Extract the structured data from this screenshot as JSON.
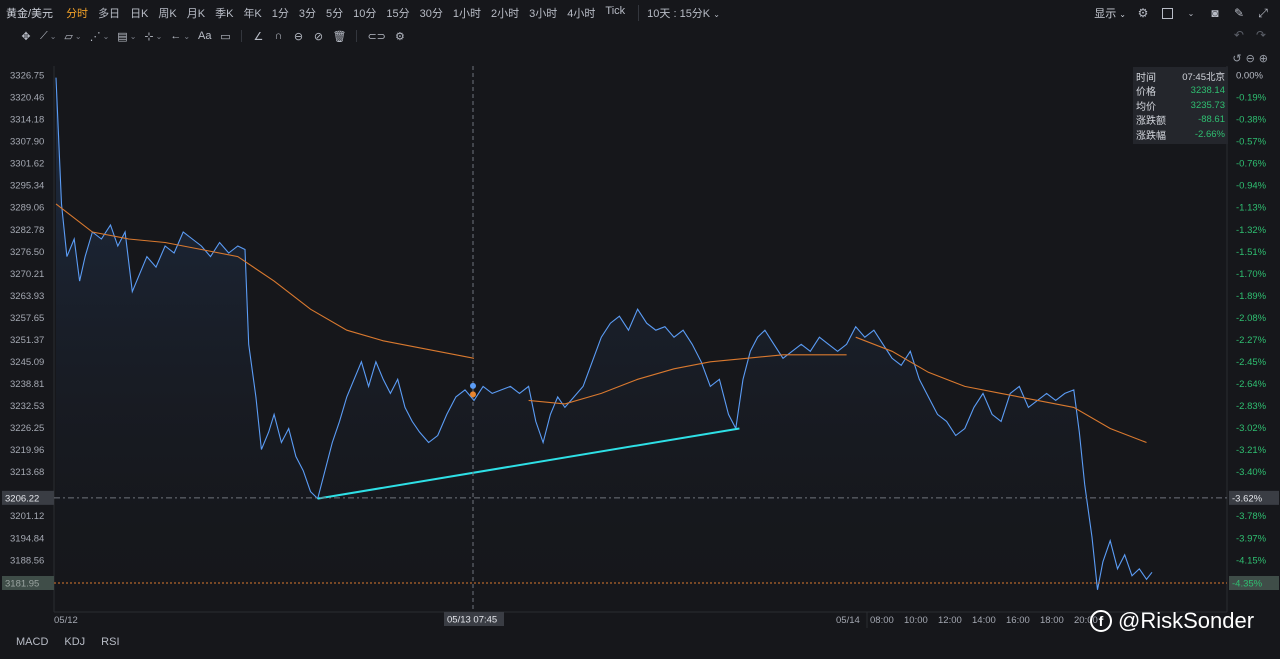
{
  "topbar": {
    "symbol": "黄金/美元",
    "timeframes": [
      "分时",
      "多日",
      "日K",
      "周K",
      "月K",
      "季K",
      "年K",
      "1分",
      "3分",
      "5分",
      "10分",
      "15分",
      "30分",
      "1小时",
      "2小时",
      "3小时",
      "4小时",
      "Tick"
    ],
    "active_timeframe": "分时",
    "range": "10天 : 15分K",
    "show_label": "显示"
  },
  "drawbar": {
    "text_tool": "Aa"
  },
  "infobox": {
    "rows": [
      {
        "key": "时间",
        "value": "07:45北京"
      },
      {
        "key": "价格",
        "value": "3238.14"
      },
      {
        "key": "均价",
        "value": "3235.73"
      },
      {
        "key": "涨跌额",
        "value": "-88.61"
      },
      {
        "key": "涨跌幅",
        "value": "-2.66%"
      }
    ]
  },
  "indicators": [
    "MACD",
    "KDJ",
    "RSI"
  ],
  "watermark": "@RiskSonder",
  "chart_data": {
    "type": "line",
    "price_labels": [
      "3326.75",
      "3320.46",
      "3314.18",
      "3307.90",
      "3301.62",
      "3295.34",
      "3289.06",
      "3282.78",
      "3276.50",
      "3270.21",
      "3263.93",
      "3257.65",
      "3251.37",
      "3245.09",
      "3238.81",
      "3232.53",
      "3226.25",
      "3219.96",
      "3213.68",
      "3201.12",
      "3194.84",
      "3188.56"
    ],
    "pct_labels": [
      "0.00%",
      "-0.19%",
      "-0.38%",
      "-0.57%",
      "-0.76%",
      "-0.94%",
      "-1.13%",
      "-1.32%",
      "-1.51%",
      "-1.70%",
      "-1.89%",
      "-2.08%",
      "-2.27%",
      "-2.45%",
      "-2.64%",
      "-2.83%",
      "-3.02%",
      "-3.21%",
      "-3.40%",
      "-3.78%",
      "-3.97%",
      "-4.15%"
    ],
    "crosshair_price": "3206.22",
    "crosshair_pct": "-3.62%",
    "current_price": "3181.95",
    "current_pct": "-4.35%",
    "ylim": [
      3181.95,
      3326.75
    ],
    "time_labels": [
      "05/12",
      "05/14",
      "08:00",
      "10:00",
      "12:00",
      "14:00",
      "16:00",
      "18:00",
      "20:00"
    ],
    "crosshair_time": "05/13 07:45",
    "price_series": [
      [
        0,
        3326
      ],
      [
        0.3,
        3290
      ],
      [
        0.6,
        3275
      ],
      [
        1,
        3280
      ],
      [
        1.3,
        3268
      ],
      [
        1.6,
        3275
      ],
      [
        2,
        3282
      ],
      [
        2.5,
        3280
      ],
      [
        3,
        3284
      ],
      [
        3.4,
        3278
      ],
      [
        3.8,
        3282
      ],
      [
        4.2,
        3265
      ],
      [
        4.6,
        3270
      ],
      [
        5,
        3275
      ],
      [
        5.5,
        3272
      ],
      [
        6,
        3278
      ],
      [
        6.5,
        3276
      ],
      [
        7,
        3282
      ],
      [
        7.5,
        3280
      ],
      [
        8,
        3278
      ],
      [
        8.5,
        3275
      ],
      [
        9,
        3279
      ],
      [
        9.5,
        3276
      ],
      [
        10,
        3278
      ],
      [
        10.4,
        3277
      ],
      [
        10.6,
        3250
      ],
      [
        11,
        3235
      ],
      [
        11.3,
        3220
      ],
      [
        11.7,
        3225
      ],
      [
        12,
        3230
      ],
      [
        12.4,
        3222
      ],
      [
        12.8,
        3226
      ],
      [
        13.2,
        3218
      ],
      [
        13.6,
        3214
      ],
      [
        14,
        3208
      ],
      [
        14.4,
        3206
      ],
      [
        14.8,
        3214
      ],
      [
        15.2,
        3222
      ],
      [
        15.6,
        3228
      ],
      [
        16,
        3235
      ],
      [
        16.4,
        3240
      ],
      [
        16.8,
        3245
      ],
      [
        17.2,
        3238
      ],
      [
        17.6,
        3245
      ],
      [
        18,
        3240
      ],
      [
        18.4,
        3236
      ],
      [
        18.8,
        3240
      ],
      [
        19.2,
        3232
      ],
      [
        19.6,
        3228
      ],
      [
        20,
        3225
      ],
      [
        20.5,
        3222
      ],
      [
        21,
        3224
      ],
      [
        21.5,
        3230
      ],
      [
        22,
        3235
      ],
      [
        22.5,
        3237
      ],
      [
        23,
        3234
      ],
      [
        23.5,
        3238
      ],
      [
        24,
        3236
      ],
      [
        24.5,
        3237
      ],
      [
        25,
        3238
      ],
      [
        25.5,
        3236
      ],
      [
        26,
        3238
      ],
      [
        26.4,
        3228
      ],
      [
        26.8,
        3222
      ],
      [
        27.2,
        3230
      ],
      [
        27.6,
        3235
      ],
      [
        28,
        3232
      ],
      [
        28.5,
        3235
      ],
      [
        29,
        3238
      ],
      [
        29.5,
        3245
      ],
      [
        30,
        3252
      ],
      [
        30.5,
        3256
      ],
      [
        31,
        3258
      ],
      [
        31.5,
        3254
      ],
      [
        32,
        3260
      ],
      [
        32.5,
        3256
      ],
      [
        33,
        3254
      ],
      [
        33.5,
        3255
      ],
      [
        34,
        3252
      ],
      [
        34.5,
        3254
      ],
      [
        35,
        3250
      ],
      [
        35.5,
        3245
      ],
      [
        36,
        3238
      ],
      [
        36.5,
        3240
      ],
      [
        37,
        3230
      ],
      [
        37.4,
        3226
      ],
      [
        37.8,
        3240
      ],
      [
        38.2,
        3248
      ],
      [
        38.6,
        3252
      ],
      [
        39,
        3254
      ],
      [
        39.5,
        3250
      ],
      [
        40,
        3246
      ],
      [
        40.5,
        3248
      ],
      [
        41,
        3250
      ],
      [
        41.5,
        3248
      ],
      [
        42,
        3252
      ],
      [
        42.5,
        3250
      ],
      [
        43,
        3248
      ],
      [
        43.5,
        3250
      ],
      [
        44,
        3255
      ],
      [
        44.5,
        3252
      ],
      [
        45,
        3254
      ],
      [
        45.5,
        3250
      ],
      [
        46,
        3246
      ],
      [
        46.5,
        3244
      ],
      [
        47,
        3248
      ],
      [
        47.5,
        3240
      ],
      [
        48,
        3235
      ],
      [
        48.5,
        3230
      ],
      [
        49,
        3228
      ],
      [
        49.5,
        3224
      ],
      [
        50,
        3226
      ],
      [
        50.5,
        3232
      ],
      [
        51,
        3236
      ],
      [
        51.5,
        3230
      ],
      [
        52,
        3228
      ],
      [
        52.5,
        3236
      ],
      [
        53,
        3238
      ],
      [
        53.5,
        3232
      ],
      [
        54,
        3234
      ],
      [
        54.5,
        3236
      ],
      [
        55,
        3234
      ],
      [
        55.5,
        3236
      ],
      [
        56,
        3237
      ],
      [
        56.3,
        3225
      ],
      [
        56.6,
        3210
      ],
      [
        57,
        3195
      ],
      [
        57.3,
        3180
      ],
      [
        57.6,
        3188
      ],
      [
        58,
        3194
      ],
      [
        58.4,
        3186
      ],
      [
        58.8,
        3190
      ],
      [
        59.2,
        3184
      ],
      [
        59.6,
        3186
      ],
      [
        60,
        3183
      ],
      [
        60.3,
        3185
      ]
    ],
    "average_series": [
      [
        0,
        3290
      ],
      [
        2,
        3282
      ],
      [
        4,
        3280
      ],
      [
        6,
        3279
      ],
      [
        8,
        3277
      ],
      [
        10,
        3275
      ],
      [
        12,
        3268
      ],
      [
        14,
        3260
      ],
      [
        16,
        3254
      ],
      [
        18,
        3251
      ],
      [
        20,
        3249
      ],
      [
        22,
        3247
      ],
      [
        23,
        3246
      ]
    ],
    "average_series_2": [
      [
        26,
        3234
      ],
      [
        28,
        3233
      ],
      [
        30,
        3236
      ],
      [
        32,
        3240
      ],
      [
        34,
        3243
      ],
      [
        36,
        3245
      ],
      [
        38,
        3246
      ],
      [
        40,
        3247
      ],
      [
        42,
        3247
      ],
      [
        43.5,
        3247
      ]
    ],
    "average_series_3": [
      [
        44,
        3252
      ],
      [
        46,
        3248
      ],
      [
        48,
        3242
      ],
      [
        50,
        3238
      ],
      [
        52,
        3236
      ],
      [
        54,
        3234
      ],
      [
        56,
        3232
      ],
      [
        58,
        3226
      ],
      [
        60,
        3222
      ]
    ],
    "trendline": [
      [
        14.4,
        3206
      ],
      [
        37.6,
        3226
      ]
    ]
  }
}
